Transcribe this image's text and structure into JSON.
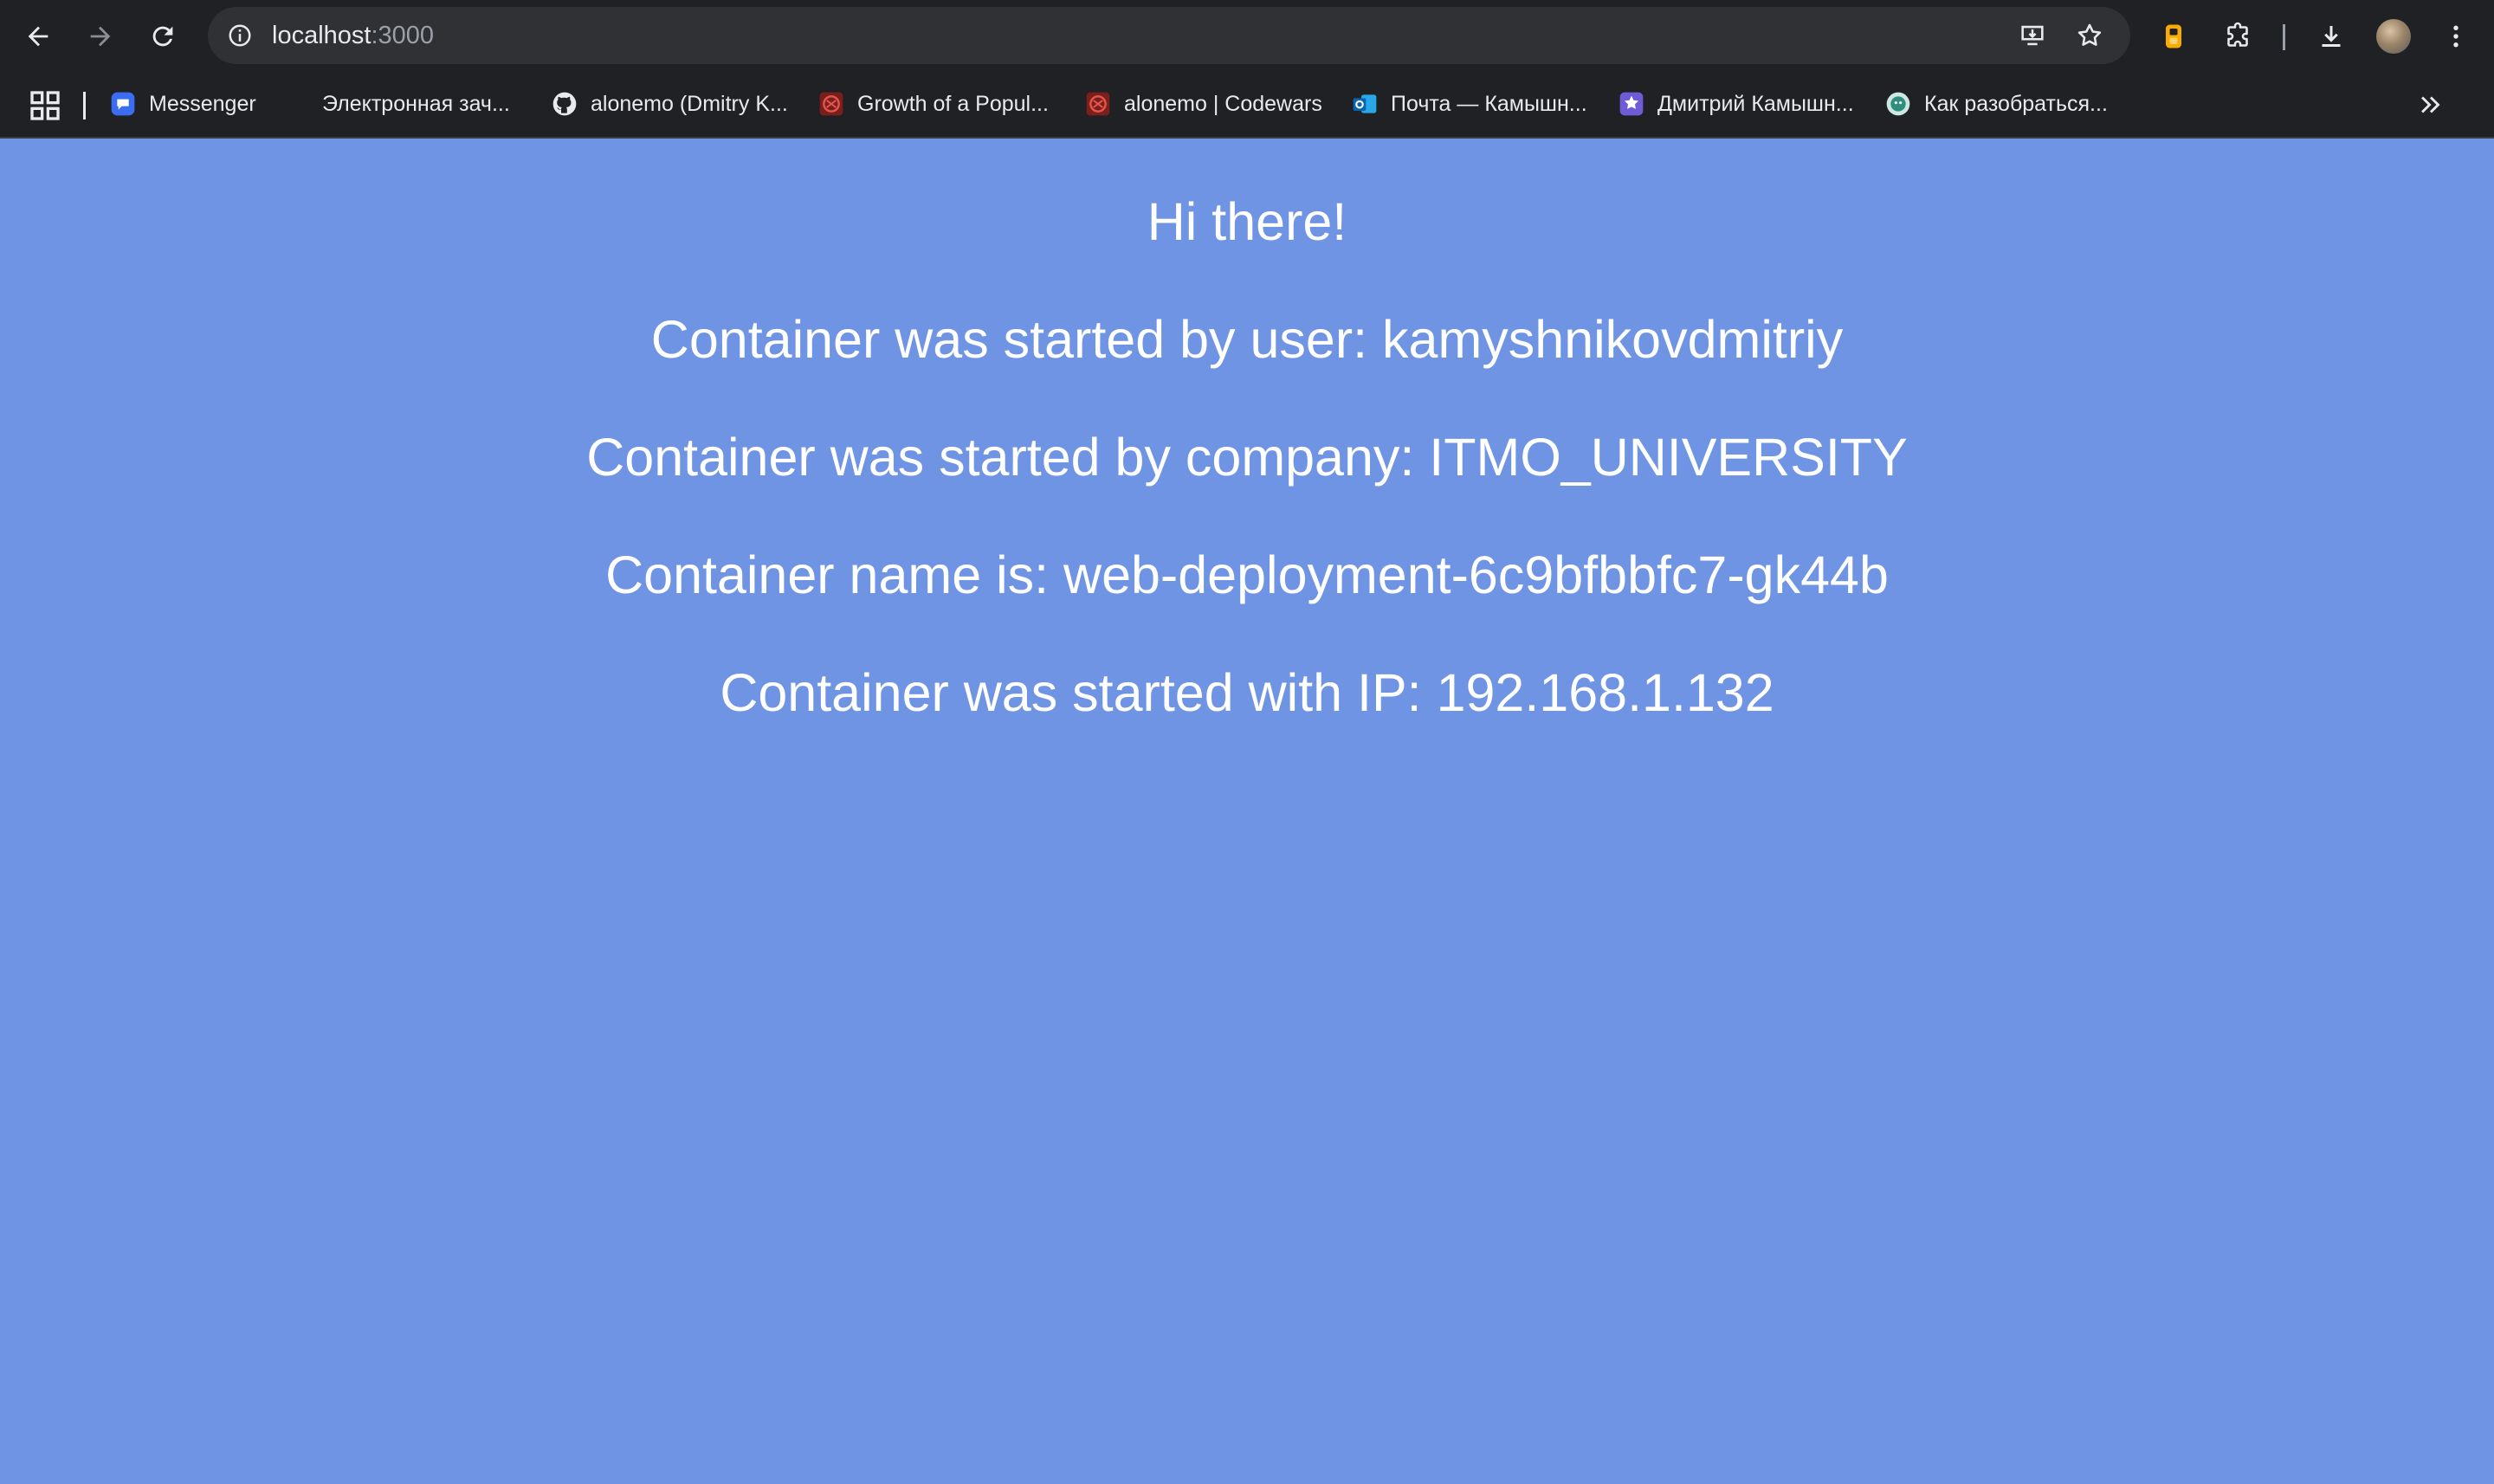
{
  "browser": {
    "url_host": "localhost",
    "url_port": ":3000",
    "colors": {
      "toolbar_bg": "#202124",
      "omnibox_bg": "#303134",
      "icon": "#e8eaed",
      "page_bg": "#6f94e3",
      "extension_accent": "#f9ab00"
    },
    "toolbar_icons": [
      "back-icon",
      "forward-icon",
      "reload-icon",
      "site-info-icon",
      "install-app-icon",
      "bookmark-star-icon",
      "extension-icon",
      "extensions-puzzle-icon",
      "download-icon",
      "profile-avatar",
      "more-menu-icon"
    ]
  },
  "bookmarks": [
    {
      "label": "Messenger",
      "icon": "messenger-icon"
    },
    {
      "label": "Электронная зач...",
      "icon": "none"
    },
    {
      "label": "alonemo (Dmitry K...",
      "icon": "github-icon"
    },
    {
      "label": "Growth of a Popul...",
      "icon": "codewars-icon"
    },
    {
      "label": "alonemo | Codewars",
      "icon": "codewars-icon"
    },
    {
      "label": "Почта — Камышн...",
      "icon": "outlook-icon"
    },
    {
      "label": "Дмитрий Камышн...",
      "icon": "profile-badge-icon"
    },
    {
      "label": "Как разобраться...",
      "icon": "chatbot-icon"
    }
  ],
  "page": {
    "greeting": "Hi there!",
    "user_line": "Container was started by user: kamyshnikovdmitriy",
    "company_line": "Container was started by company: ITMO_UNIVERSITY",
    "name_line": "Container name is: web-deployment-6c9bfbbfc7-gk44b",
    "ip_line": "Container was started with IP: 192.168.1.132"
  }
}
